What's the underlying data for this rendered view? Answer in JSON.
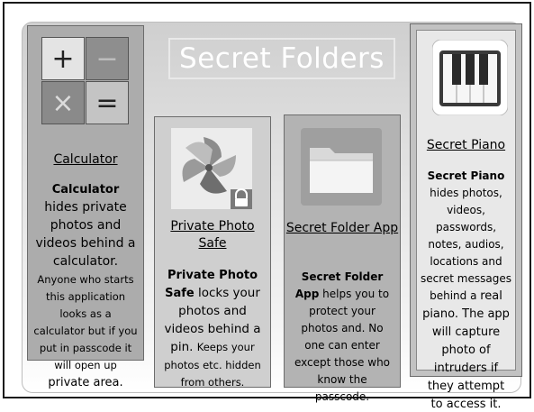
{
  "title": "Secret Folders",
  "calculator": {
    "keys": [
      "+",
      "−",
      "×",
      "="
    ],
    "name": "Calculator",
    "bold": "Calculator",
    "text1": " hides private photos and videos behind a calculator. ",
    "text2": "Anyone who starts this application looks as a calculator but if you put in passcode it will open up ",
    "text3": "private area."
  },
  "photo_safe": {
    "name": "Private Photo Safe",
    "bold": "Private Photo Safe",
    "text1": " locks your photos and videos behind a pin. ",
    "text2": "Keeps your photos etc. hidden from others."
  },
  "folder_app": {
    "name": "Secret Folder App",
    "bold": "Secret Folder App",
    "text1": " helps you to protect your photos and. No one can enter except those who know the passcode."
  },
  "piano": {
    "name": "Secret Piano",
    "bold": "Secret Piano",
    "text1": " hides photos, videos, passwords, notes, audios, locations and secret messages behind a ",
    "text2": "real piano.",
    "text3": " The app will capture photo of intruders if they attempt to access it."
  }
}
